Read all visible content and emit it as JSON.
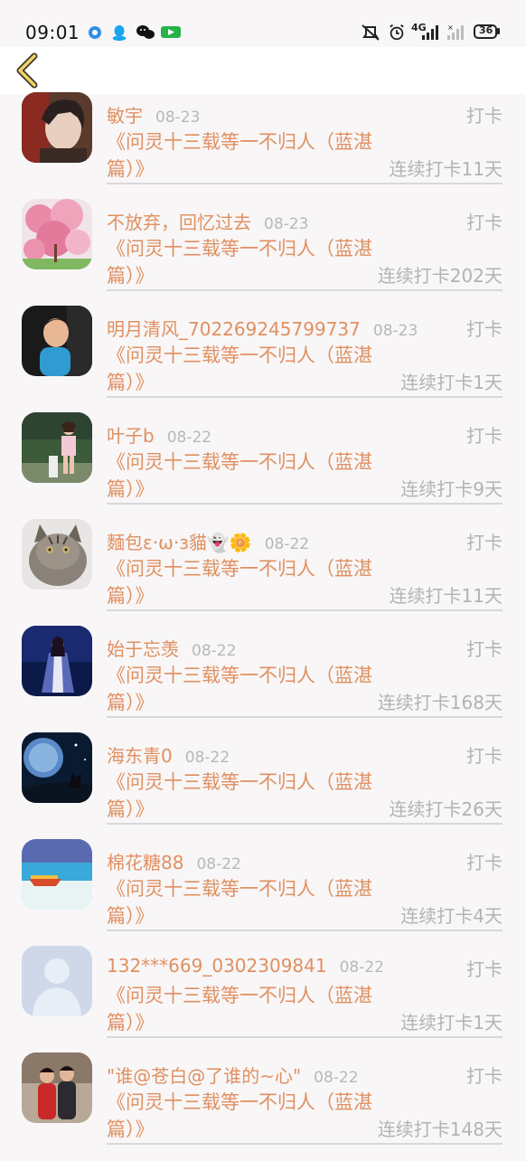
{
  "status_bar": {
    "time": "09:01",
    "network": "4G",
    "battery": "36"
  },
  "header": {
    "back_icon": "chevron-left-icon"
  },
  "list": {
    "action_label": "打卡",
    "items": [
      {
        "name": "敏宇",
        "date": "08-23",
        "title": "《问灵十三载等一不归人（蓝湛篇）》",
        "streak": "连续打卡11天",
        "avatar": "anime-man"
      },
      {
        "name": "不放弃，回忆过去",
        "date": "08-23",
        "title": "《问灵十三载等一不归人（蓝湛篇）》",
        "streak": "连续打卡202天",
        "avatar": "pink-blossoms"
      },
      {
        "name": "明月清风_702269245799737",
        "date": "08-23",
        "title": "《问灵十三载等一不归人（蓝湛篇）》",
        "streak": "连续打卡1天",
        "avatar": "child"
      },
      {
        "name": "叶子b",
        "date": "08-22",
        "title": "《问灵十三载等一不归人（蓝湛篇）》",
        "streak": "连续打卡9天",
        "avatar": "girl-outdoor"
      },
      {
        "name": "麵包ε·ω·з貓👻🌼",
        "date": "08-22",
        "title": "《问灵十三载等一不归人（蓝湛篇）》",
        "streak": "连续打卡11天",
        "avatar": "cat"
      },
      {
        "name": "始于忘羡",
        "date": "08-22",
        "title": "《问灵十三载等一不归人（蓝湛篇）》",
        "streak": "连续打卡168天",
        "avatar": "costume-figure"
      },
      {
        "name": "海东青0",
        "date": "08-22",
        "title": "《问灵十三载等一不归人（蓝湛篇）》",
        "streak": "连续打卡26天",
        "avatar": "night-wolf"
      },
      {
        "name": "棉花糖88",
        "date": "08-22",
        "title": "《问灵十三载等一不归人（蓝湛篇）》",
        "streak": "连续打卡4天",
        "avatar": "beach-boat"
      },
      {
        "name": "132***669_0302309841",
        "date": "08-22",
        "title": "《问灵十三载等一不归人（蓝湛篇）》",
        "streak": "连续打卡1天",
        "avatar": "default-person"
      },
      {
        "name": "\"谁@苍白@了谁的~心\"",
        "date": "08-22",
        "title": "《问灵十三载等一不归人（蓝湛篇）》",
        "streak": "连续打卡148天",
        "avatar": "two-kids"
      }
    ]
  }
}
